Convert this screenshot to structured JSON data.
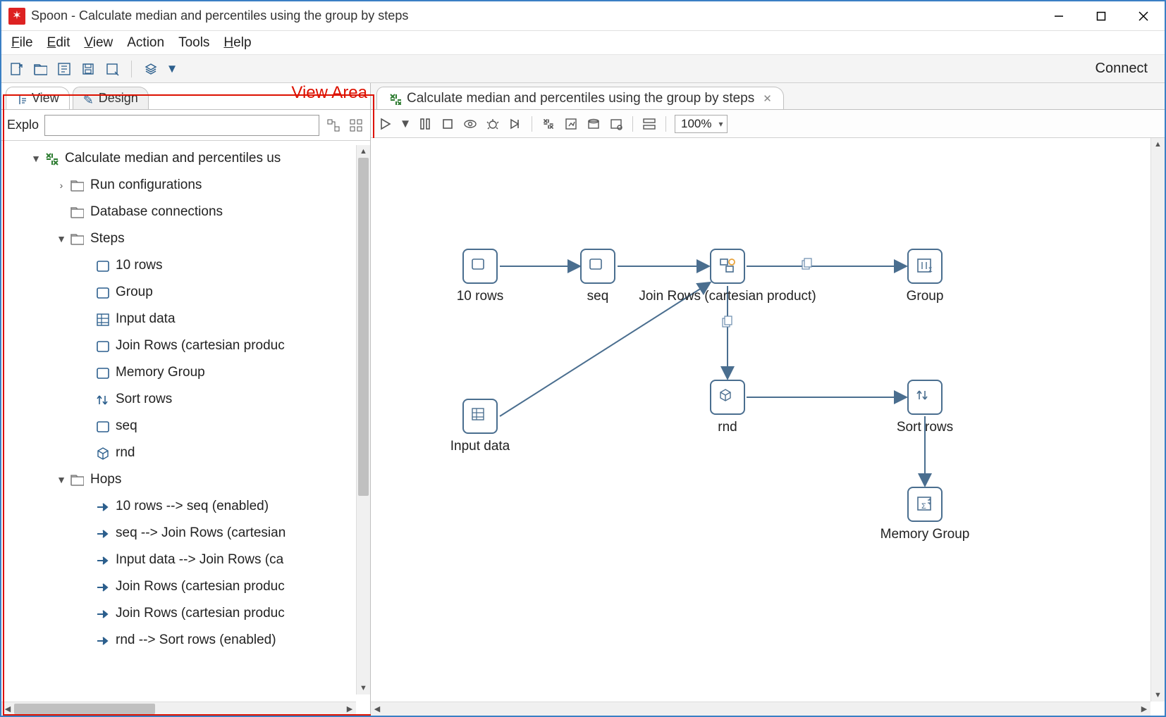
{
  "window": {
    "title": "Spoon - Calculate median and percentiles using the group by steps"
  },
  "menubar": {
    "file": "File",
    "edit": "Edit",
    "view": "View",
    "action": "Action",
    "tools": "Tools",
    "help": "Help"
  },
  "toolbar": {
    "connect": "Connect"
  },
  "sidebar": {
    "annotation": "View Area",
    "tabs": {
      "view": "View",
      "design": "Design"
    },
    "search_label": "Explo",
    "root": "Calculate median and percentiles us",
    "run_cfg": "Run configurations",
    "db_conn": "Database connections",
    "steps_label": "Steps",
    "steps": [
      "10 rows",
      "Group",
      "Input data",
      "Join Rows (cartesian produc",
      "Memory Group",
      "Sort rows",
      "seq",
      "rnd"
    ],
    "hops_label": "Hops",
    "hops": [
      "10 rows --> seq (enabled)",
      "seq --> Join Rows (cartesian",
      "Input data --> Join Rows (ca",
      "Join Rows (cartesian produc",
      "Join Rows (cartesian produc",
      "rnd --> Sort rows (enabled)"
    ]
  },
  "canvas": {
    "tab_title": "Calculate median and percentiles using the group by steps",
    "zoom": "100%",
    "nodes": {
      "ten_rows": "10 rows",
      "seq": "seq",
      "join": "Join Rows (cartesian product)",
      "group": "Group",
      "input_data": "Input data",
      "rnd": "rnd",
      "sort": "Sort rows",
      "memgroup": "Memory Group"
    }
  }
}
